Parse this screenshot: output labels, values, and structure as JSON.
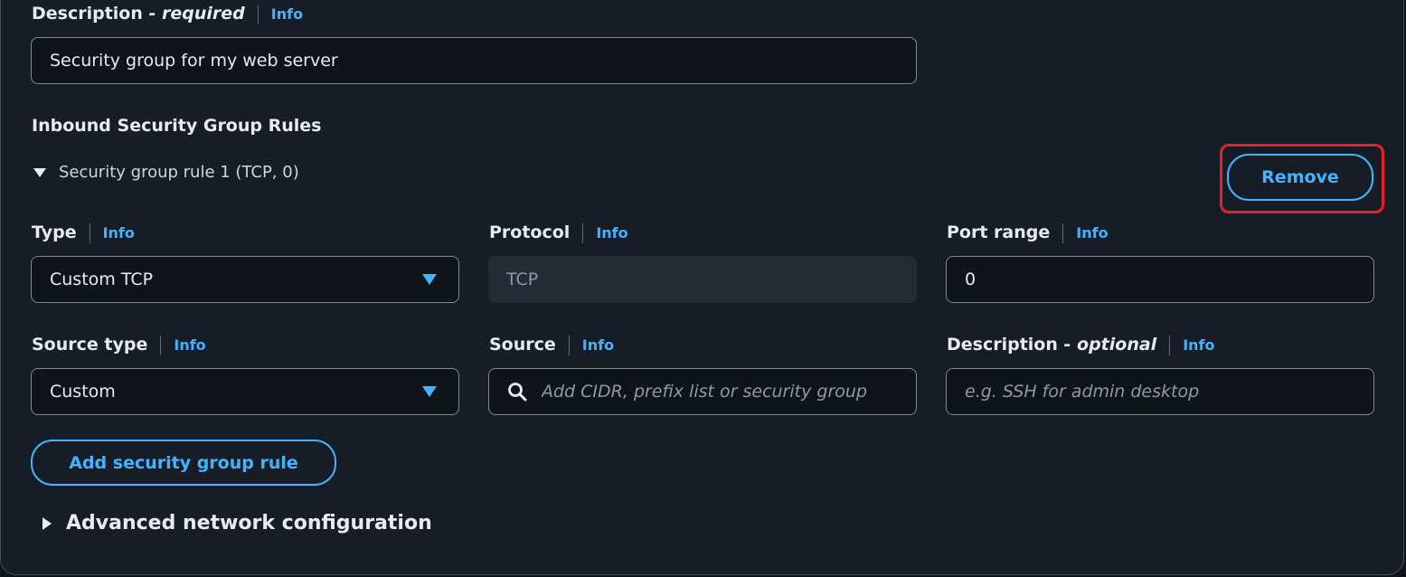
{
  "description": {
    "label": "Description",
    "qualifier": "- required",
    "info": "Info",
    "value": "Security group for my web server"
  },
  "inbound": {
    "title": "Inbound Security Group Rules",
    "rule_title": "Security group rule 1 (TCP, 0)",
    "remove_label": "Remove",
    "type": {
      "label": "Type",
      "info": "Info",
      "value": "Custom TCP"
    },
    "protocol": {
      "label": "Protocol",
      "info": "Info",
      "value": "TCP"
    },
    "port_range": {
      "label": "Port range",
      "info": "Info",
      "value": "0"
    },
    "source_type": {
      "label": "Source type",
      "info": "Info",
      "value": "Custom"
    },
    "source": {
      "label": "Source",
      "info": "Info",
      "placeholder": "Add CIDR, prefix list or security group"
    },
    "rule_description": {
      "label": "Description",
      "qualifier": "- optional",
      "info": "Info",
      "placeholder": "e.g. SSH for admin desktop"
    },
    "add_rule_label": "Add security group rule"
  },
  "advanced": {
    "label": "Advanced network configuration"
  },
  "colors": {
    "accent": "#42b4ff",
    "highlight": "#e8202b",
    "background": "#161d26"
  }
}
